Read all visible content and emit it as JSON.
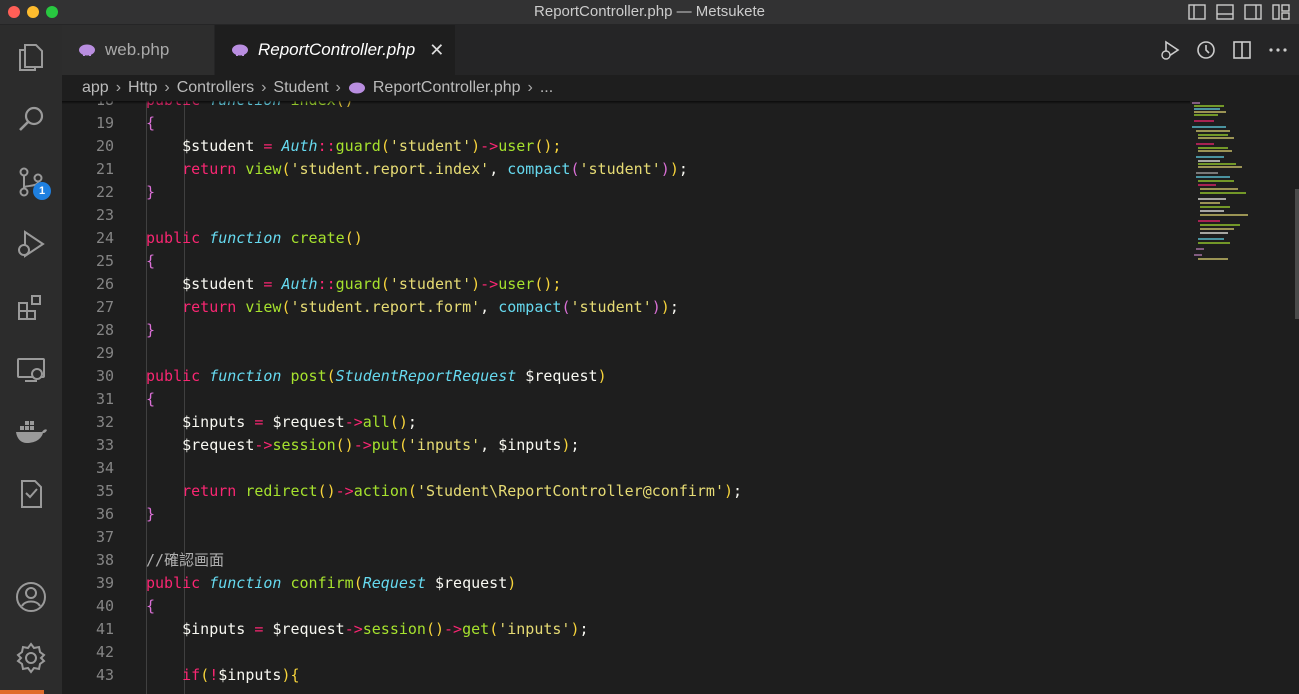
{
  "window": {
    "title": "ReportController.php — Metsukete"
  },
  "activity_bar": {
    "scm_badge": "1"
  },
  "tabs": [
    {
      "label": "web.php"
    },
    {
      "label": "ReportController.php",
      "close": "✕"
    }
  ],
  "breadcrumb": [
    "app",
    "Http",
    "Controllers",
    "Student",
    "ReportController.php",
    "..."
  ],
  "code_lines": [
    {
      "n": "18",
      "text": "public function index()"
    },
    {
      "n": "19"
    },
    {
      "n": "20"
    },
    {
      "n": "21"
    },
    {
      "n": "22"
    },
    {
      "n": "23"
    },
    {
      "n": "24"
    },
    {
      "n": "25"
    },
    {
      "n": "26"
    },
    {
      "n": "27"
    },
    {
      "n": "28"
    },
    {
      "n": "29"
    },
    {
      "n": "30"
    },
    {
      "n": "31"
    },
    {
      "n": "32"
    },
    {
      "n": "33"
    },
    {
      "n": "34"
    },
    {
      "n": "35"
    },
    {
      "n": "36"
    },
    {
      "n": "37"
    },
    {
      "n": "38"
    },
    {
      "n": "39"
    },
    {
      "n": "40"
    },
    {
      "n": "41"
    },
    {
      "n": "42"
    },
    {
      "n": "43"
    }
  ],
  "tokens": {
    "l19": [
      "{"
    ],
    "l20": [
      "$student",
      " = ",
      "Auth",
      "::",
      "guard",
      "(",
      "'student'",
      ")",
      "->",
      "user",
      "();"
    ],
    "l21": [
      "return",
      " view",
      "(",
      "'student.report.index'",
      ", ",
      "compact",
      "(",
      "'student'",
      ")",
      ")",
      ";"
    ],
    "l22": [
      "}"
    ],
    "l24": [
      "public",
      " function",
      " create",
      "()"
    ],
    "l25": [
      "{"
    ],
    "l26": [
      "$student",
      " = ",
      "Auth",
      "::",
      "guard",
      "(",
      "'student'",
      ")",
      "->",
      "user",
      "();"
    ],
    "l27": [
      "return",
      " view",
      "(",
      "'student.report.form'",
      ", ",
      "compact",
      "(",
      "'student'",
      ")",
      ")",
      ";"
    ],
    "l28": [
      "}"
    ],
    "l30": [
      "public",
      " function",
      " post",
      "(",
      "StudentReportRequest",
      " $request",
      ")"
    ],
    "l31": [
      "{"
    ],
    "l32": [
      "$inputs",
      " = ",
      "$request",
      "->",
      "all",
      "()",
      ";"
    ],
    "l33": [
      "$request",
      "->",
      "session",
      "()",
      "->",
      "put",
      "(",
      "'inputs'",
      ", ",
      "$inputs",
      ")",
      ";"
    ],
    "l35": [
      "return",
      " redirect",
      "()",
      "->",
      "action",
      "(",
      "'Student\\ReportController@confirm'",
      ")",
      ";"
    ],
    "l36": [
      "}"
    ],
    "l38": [
      "//確認画面"
    ],
    "l39": [
      "public",
      " function",
      " confirm",
      "(",
      "Request",
      " $request",
      ")"
    ],
    "l40": [
      "{"
    ],
    "l41": [
      "$inputs",
      " = ",
      "$request",
      "->",
      "session",
      "()",
      "->",
      "get",
      "(",
      "'inputs'",
      ")",
      ";"
    ],
    "l43": [
      "if",
      "(",
      "!",
      "$inputs",
      "){"
    ]
  },
  "icons": {
    "activity": [
      "files-icon",
      "search-icon",
      "source-control-icon",
      "run-debug-icon",
      "extensions-icon",
      "remote-explorer-icon",
      "docker-icon",
      "test-report-icon",
      "account-icon",
      "settings-gear-icon"
    ]
  }
}
